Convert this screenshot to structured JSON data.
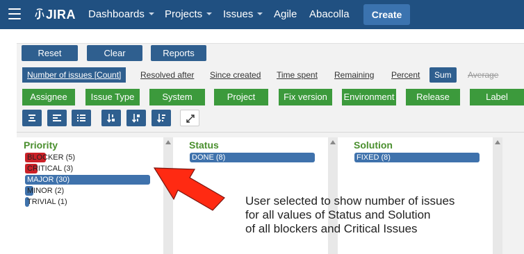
{
  "header": {
    "logo_text": "JIRA",
    "nav": [
      {
        "label": "Dashboards",
        "dropdown": true
      },
      {
        "label": "Projects",
        "dropdown": true
      },
      {
        "label": "Issues",
        "dropdown": true
      },
      {
        "label": "Agile",
        "dropdown": false
      },
      {
        "label": "Abacolla",
        "dropdown": false
      }
    ],
    "create_label": "Create"
  },
  "toolbar": {
    "actions": [
      "Reset",
      "Clear",
      "Reports"
    ],
    "measures": [
      {
        "label": "Number of issues [Count]",
        "state": "selected"
      },
      {
        "label": "Resolved after",
        "state": "normal"
      },
      {
        "label": "Since created",
        "state": "normal"
      },
      {
        "label": "Time spent",
        "state": "normal"
      },
      {
        "label": "Remaining",
        "state": "normal"
      },
      {
        "label": "Percent",
        "state": "normal"
      },
      {
        "label": "Sum",
        "state": "active"
      },
      {
        "label": "Average",
        "state": "disabled"
      }
    ],
    "dimensions": [
      "Assignee",
      "Issue Type",
      "System",
      "Project",
      "Fix version",
      "Environment",
      "Release",
      "Label"
    ],
    "view_icons": [
      "align-center-icon",
      "align-left-icon",
      "list-icon",
      "sort-asc-icon",
      "sort-desc-icon",
      "sort-amount-icon",
      "expand-icon"
    ]
  },
  "columns": {
    "priority": {
      "title": "Priority",
      "items": [
        {
          "label": "BLOCKER (5)",
          "value": 5,
          "selected": true,
          "color": "#cc2027"
        },
        {
          "label": "CRITICAL (3)",
          "value": 3,
          "selected": true,
          "color": "#cc2027"
        },
        {
          "label": "MAJOR (30)",
          "value": 30,
          "selected": false,
          "color": "#3f72ac"
        },
        {
          "label": "MINOR (2)",
          "value": 2,
          "selected": false,
          "color": "#3f72ac"
        },
        {
          "label": "TRIVIAL (1)",
          "value": 1,
          "selected": false,
          "color": "#3f72ac"
        }
      ]
    },
    "status": {
      "title": "Status",
      "items": [
        {
          "label": "DONE (8)",
          "value": 8,
          "color": "#3f72ac"
        }
      ]
    },
    "solution": {
      "title": "Solution",
      "items": [
        {
          "label": "FIXED (8)",
          "value": 8,
          "color": "#3f72ac"
        }
      ]
    }
  },
  "annotation": {
    "lines": [
      "User selected to show number of issues",
      "for all values of Status and Solution",
      "of all blockers and Critical Issues"
    ],
    "arrow_color": "#ff2a12"
  }
}
